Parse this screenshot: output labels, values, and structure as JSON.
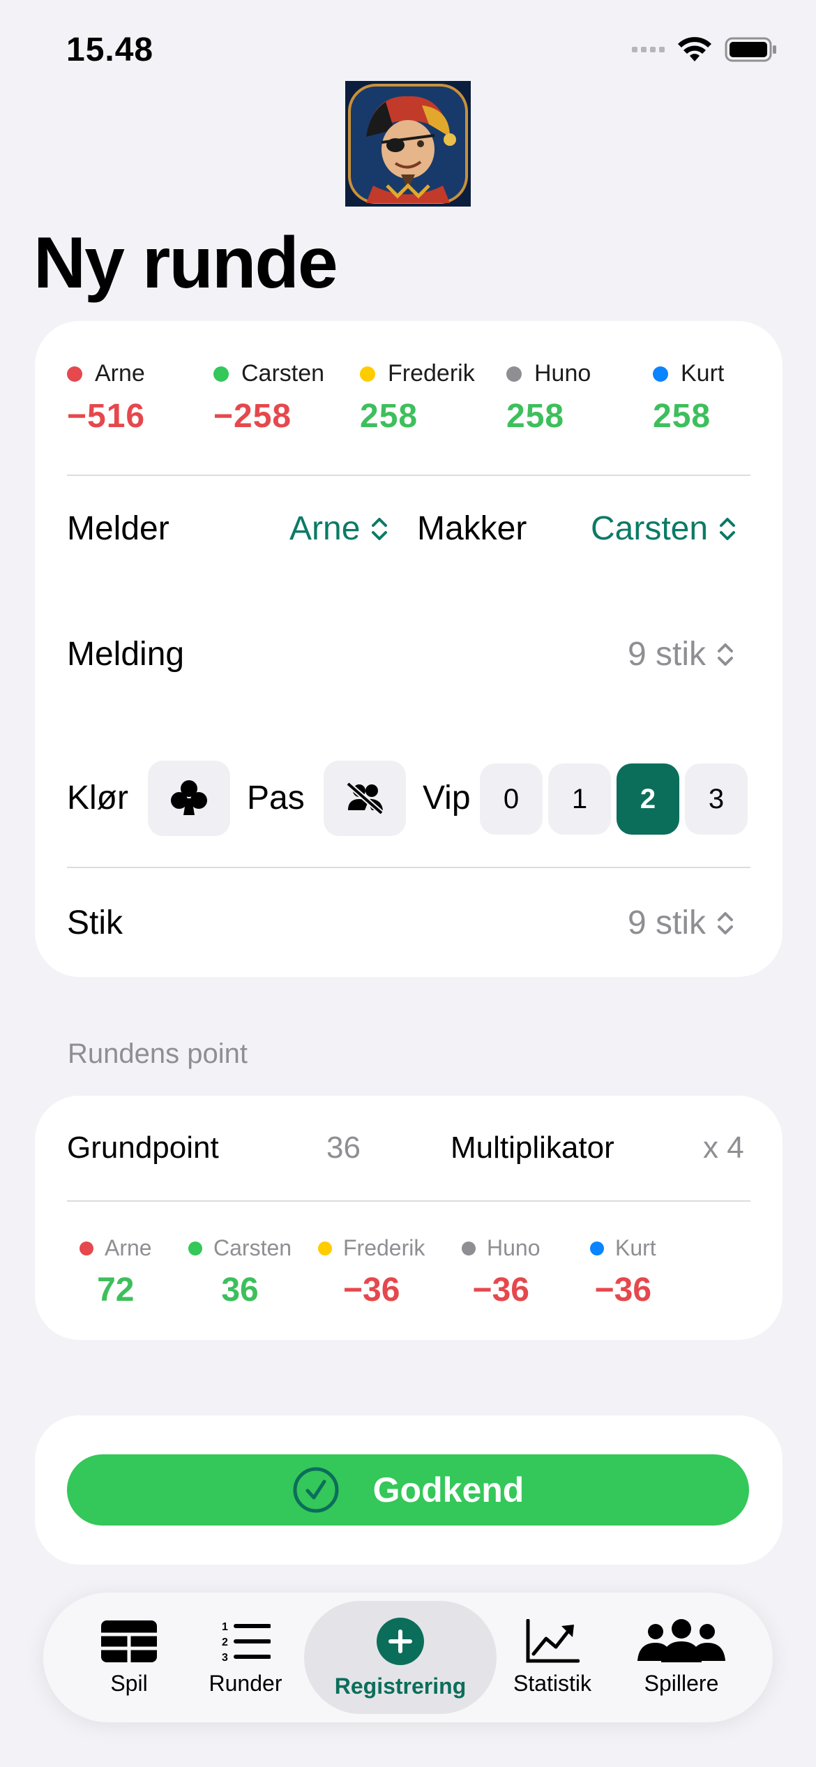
{
  "status": {
    "time": "15.48"
  },
  "title": "Ny runde",
  "scores": [
    {
      "name": "Arne",
      "value": "−516",
      "color": "#e5484d",
      "sign": "neg"
    },
    {
      "name": "Carsten",
      "value": "−258",
      "color": "#34c759",
      "sign": "neg"
    },
    {
      "name": "Frederik",
      "value": "258",
      "color": "#ffcc00",
      "sign": "pos"
    },
    {
      "name": "Huno",
      "value": "258",
      "color": "#8e8e93",
      "sign": "pos"
    },
    {
      "name": "Kurt",
      "value": "258",
      "color": "#0a84ff",
      "sign": "pos"
    }
  ],
  "melder": {
    "label": "Melder",
    "value": "Arne"
  },
  "makker": {
    "label": "Makker",
    "value": "Carsten"
  },
  "melding": {
    "label": "Melding",
    "value": "9 stik"
  },
  "suit": {
    "label": "Klør",
    "icon": "club-icon"
  },
  "pas": {
    "label": "Pas",
    "icon": "no-partner-icon"
  },
  "vip": {
    "label": "Vip",
    "options": [
      "0",
      "1",
      "2",
      "3"
    ],
    "selected": "2"
  },
  "stik": {
    "label": "Stik",
    "value": "9 stik"
  },
  "round_points": {
    "header": "Rundens point",
    "base_label": "Grundpoint",
    "base_value": "36",
    "mult_label": "Multiplikator",
    "mult_value": "x 4",
    "players": [
      {
        "name": "Arne",
        "value": "72",
        "color": "#e5484d",
        "sign": "pos"
      },
      {
        "name": "Carsten",
        "value": "36",
        "color": "#34c759",
        "sign": "pos"
      },
      {
        "name": "Frederik",
        "value": "−36",
        "color": "#ffcc00",
        "sign": "neg"
      },
      {
        "name": "Huno",
        "value": "−36",
        "color": "#8e8e93",
        "sign": "neg"
      },
      {
        "name": "Kurt",
        "value": "−36",
        "color": "#0a84ff",
        "sign": "neg"
      }
    ]
  },
  "approve_button": {
    "label": "Godkend",
    "icon": "checkmark-circle-icon"
  },
  "tabs": [
    {
      "label": "Spil",
      "icon": "grid-icon"
    },
    {
      "label": "Runder",
      "icon": "numbered-list-icon"
    },
    {
      "label": "Registrering",
      "icon": "plus-circle-icon",
      "active": true
    },
    {
      "label": "Statistik",
      "icon": "chart-line-icon"
    },
    {
      "label": "Spillere",
      "icon": "people-icon"
    }
  ],
  "colors": {
    "accent": "#0b6e5b",
    "positive": "#3dbf5c",
    "negative": "#e5484d",
    "confirm": "#34c759"
  }
}
